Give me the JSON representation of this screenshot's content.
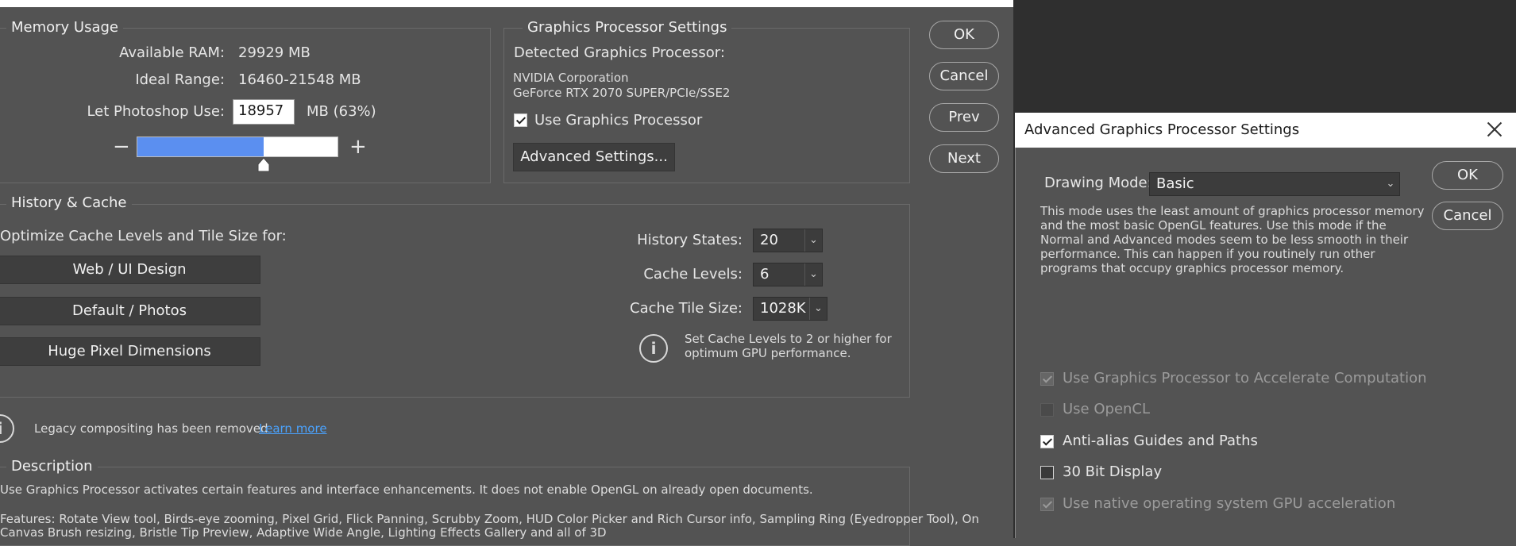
{
  "memory": {
    "title": "Memory Usage",
    "available_ram_label": "Available RAM:",
    "available_ram_value": "29929 MB",
    "ideal_range_label": "Ideal Range:",
    "ideal_range_value": "16460-21548 MB",
    "let_use_label": "Let Photoshop Use:",
    "let_use_value": "18957",
    "let_use_suffix": "MB (63%)",
    "slider_fraction": 0.63,
    "minus": "−",
    "plus": "+"
  },
  "gpu": {
    "title": "Graphics Processor Settings",
    "detected_label": "Detected Graphics Processor:",
    "vendor": "NVIDIA Corporation",
    "model": "GeForce RTX 2070 SUPER/PCIe/SSE2",
    "use_gpu_label": "Use Graphics Processor",
    "use_gpu_checked": true,
    "advanced_button": "Advanced Settings..."
  },
  "side_buttons": {
    "ok": "OK",
    "cancel": "Cancel",
    "prev": "Prev",
    "next": "Next"
  },
  "history": {
    "title": "History & Cache",
    "optimize_label": "Optimize Cache Levels and Tile Size for:",
    "preset_web": "Web / UI Design",
    "preset_default": "Default / Photos",
    "preset_huge": "Huge Pixel Dimensions",
    "history_states_label": "History States:",
    "history_states_value": "20",
    "cache_levels_label": "Cache Levels:",
    "cache_levels_value": "6",
    "cache_tile_label": "Cache Tile Size:",
    "cache_tile_value": "1028K",
    "info_line1": "Set Cache Levels to 2 or higher for",
    "info_line2": "optimum GPU performance."
  },
  "legacy": {
    "text": "Legacy compositing has been removed",
    "link": "Learn more"
  },
  "description": {
    "title": "Description",
    "line1": "Use Graphics Processor activates certain features and interface enhancements. It does not enable OpenGL on already open documents.",
    "line2": "Features: Rotate View tool, Birds-eye zooming, Pixel Grid, Flick Panning, Scrubby Zoom, HUD Color Picker and Rich Cursor info, Sampling Ring (Eyedropper Tool), On",
    "line3": "Canvas Brush resizing, Bristle Tip Preview, Adaptive Wide Angle, Lighting Effects Gallery and all of 3D"
  },
  "dialog": {
    "title": "Advanced Graphics Processor Settings",
    "drawing_mode_label": "Drawing Mode:",
    "drawing_mode_value": "Basic",
    "ok": "OK",
    "cancel": "Cancel",
    "desc1": "This mode uses the least amount of graphics processor memory",
    "desc2": "and the most basic OpenGL features.  Use this mode if the",
    "desc3": "Normal and Advanced modes seem to be less smooth in their",
    "desc4": "performance.  This can happen if you routinely run other",
    "desc5": "programs that occupy graphics processor memory.",
    "options": [
      {
        "label": "Use Graphics Processor to Accelerate Computation",
        "checked": true,
        "enabled": false
      },
      {
        "label": "Use OpenCL",
        "checked": false,
        "enabled": false
      },
      {
        "label": "Anti-alias Guides and Paths",
        "checked": true,
        "enabled": true
      },
      {
        "label": "30 Bit Display",
        "checked": false,
        "enabled": true
      },
      {
        "label": "Use native operating system GPU acceleration",
        "checked": true,
        "enabled": false
      }
    ]
  },
  "colors": {
    "panel_bg": "#535353",
    "dark_bg": "#2f2f2f",
    "slider_fill": "#5b8ff0",
    "link": "#4aa3ff"
  }
}
